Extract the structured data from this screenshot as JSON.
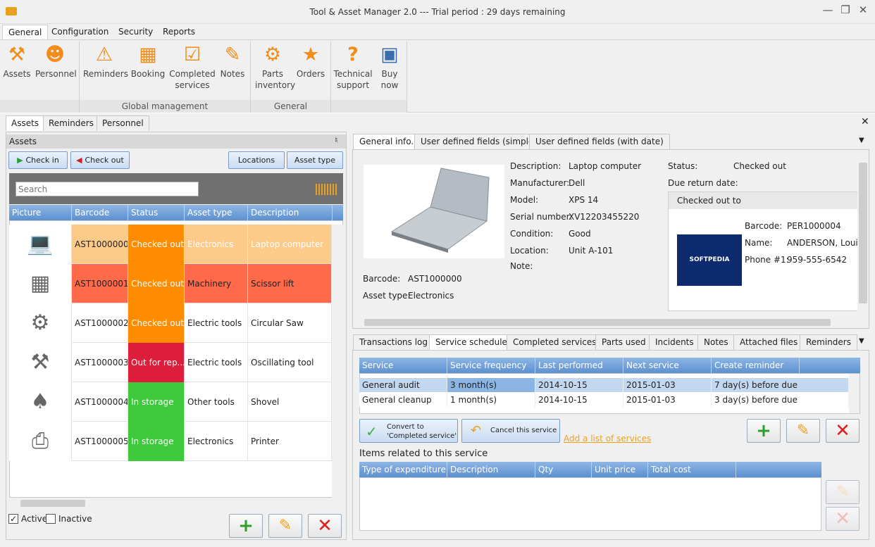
{
  "window": {
    "title": "Tool & Asset Manager 2.0 --- Trial period : 29 days remaining"
  },
  "ribbon": {
    "tabs": [
      "General",
      "Configuration",
      "Security",
      "Reports"
    ],
    "buttons": {
      "assets": "Assets",
      "personnel": "Personnel",
      "reminders": "Reminders",
      "booking": "Booking",
      "completed_1": "Completed",
      "completed_2": "services",
      "notes": "Notes",
      "parts_1": "Parts",
      "parts_2": "inventory",
      "orders": "Orders",
      "tech_1": "Technical",
      "tech_2": "support",
      "buy_1": "Buy",
      "buy_2": "now"
    },
    "groups": {
      "global": "Global management",
      "general": "General"
    }
  },
  "doc_tabs": [
    "Assets",
    "Reminders",
    "Personnel"
  ],
  "assets_panel": {
    "title": "Assets",
    "check_in": "Check in",
    "check_out": "Check out",
    "locations": "Locations",
    "asset_type": "Asset type",
    "search_placeholder": "Search",
    "columns": [
      "Picture",
      "Barcode",
      "Status",
      "Asset type",
      "Description"
    ],
    "rows": [
      {
        "barcode": "AST1000000",
        "status": "Checked out",
        "type": "Electronics",
        "description": "Laptop computer",
        "picture": "laptop",
        "row_bg": "#fccb8a",
        "status_bg": "#ff8c00"
      },
      {
        "barcode": "AST1000001",
        "status": "Checked out",
        "type": "Machinery",
        "description": "Scissor lift",
        "picture": "scissor-lift",
        "row_bg": "#ff6b4a",
        "status_bg": "#ff8c00"
      },
      {
        "barcode": "AST1000002",
        "status": "Checked out",
        "type": "Electric tools",
        "description": "Circular Saw",
        "picture": "circular-saw",
        "row_bg": "#ffffff",
        "status_bg": "#ff8c00"
      },
      {
        "barcode": "AST1000003",
        "status": "Out for rep...",
        "type": "Electric tools",
        "description": "Oscillating tool",
        "picture": "oscillating-tool",
        "row_bg": "#ffffff",
        "status_bg": "#dc1e3c"
      },
      {
        "barcode": "AST1000004",
        "status": "In storage",
        "type": "Other tools",
        "description": "Shovel",
        "picture": "shovel",
        "row_bg": "#ffffff",
        "status_bg": "#3ec83c"
      },
      {
        "barcode": "AST1000005",
        "status": "In storage",
        "type": "Electronics",
        "description": "Printer",
        "picture": "printer",
        "row_bg": "#ffffff",
        "status_bg": "#3ec83c"
      }
    ],
    "active": "Active",
    "inactive": "Inactive"
  },
  "info_tabs": [
    "General info.",
    "User defined fields (simple)",
    "User defined fields (with date)"
  ],
  "general_info": {
    "description_label": "Description:",
    "description": "Laptop computer",
    "manufacturer_label": "Manufacturer:",
    "manufacturer": "Dell",
    "model_label": "Model:",
    "model": "XPS 14",
    "serial_label": "Serial number:",
    "serial": "XV12203455220",
    "condition_label": "Condition:",
    "condition": "Good",
    "location_label": "Location:",
    "location": "Unit A-101",
    "note_label": "Note:",
    "barcode_label": "Barcode:",
    "barcode": "AST1000000",
    "asset_type_label": "Asset type:",
    "asset_type": "Electronics",
    "status_label": "Status:",
    "status": "Checked out",
    "due_label": "Due return date:",
    "checked_out_to": "Checked out to",
    "person_barcode_label": "Barcode:",
    "person_barcode": "PER1000004",
    "name_label": "Name:",
    "name": "ANDERSON, Louise",
    "phone_label": "Phone #1:",
    "phone": "959-555-6542",
    "logo_text": "SOFTPEDIA"
  },
  "service_tabs": [
    "Transactions log",
    "Service schedule",
    "Completed services",
    "Parts used",
    "Incidents",
    "Notes",
    "Attached files",
    "Reminders"
  ],
  "services": {
    "columns": [
      "Service",
      "Service frequency",
      "Last performed",
      "Next service",
      "Create reminder"
    ],
    "rows": [
      {
        "service": "General audit",
        "frequency": "3 month(s)",
        "last": "2014-10-15",
        "next": "2015-01-03",
        "reminder": "7 day(s) before due"
      },
      {
        "service": "General cleanup",
        "frequency": "1 month(s)",
        "last": "2014-10-15",
        "next": "2015-01-03",
        "reminder": "3 day(s) before due"
      }
    ],
    "convert_1": "Convert to",
    "convert_2": "'Completed service'",
    "cancel": "Cancel this service",
    "add_list": "Add a list of services",
    "items_title": "Items related to this service",
    "item_columns": [
      "Type of expenditure",
      "Description",
      "Qty",
      "Unit price",
      "Total cost"
    ]
  }
}
